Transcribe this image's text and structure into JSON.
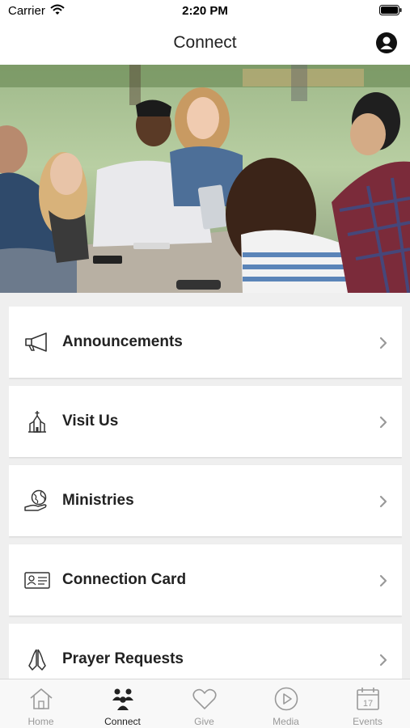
{
  "status_bar": {
    "carrier": "Carrier",
    "time": "2:20 PM"
  },
  "nav": {
    "title": "Connect"
  },
  "menu": [
    {
      "label": "Announcements",
      "icon": "megaphone-icon"
    },
    {
      "label": "Visit Us",
      "icon": "church-icon"
    },
    {
      "label": "Ministries",
      "icon": "globe-hand-icon"
    },
    {
      "label": "Connection Card",
      "icon": "id-card-icon"
    },
    {
      "label": "Prayer Requests",
      "icon": "praying-hands-icon"
    }
  ],
  "tabs": [
    {
      "label": "Home",
      "icon": "home-icon",
      "active": false
    },
    {
      "label": "Connect",
      "icon": "people-icon",
      "active": true
    },
    {
      "label": "Give",
      "icon": "heart-icon",
      "active": false
    },
    {
      "label": "Media",
      "icon": "play-icon",
      "active": false
    },
    {
      "label": "Events",
      "icon": "calendar-icon",
      "active": false,
      "badge_text": "17"
    }
  ],
  "colors": {
    "accent_active": "#222222",
    "inactive": "#999999",
    "background": "#efefef"
  }
}
